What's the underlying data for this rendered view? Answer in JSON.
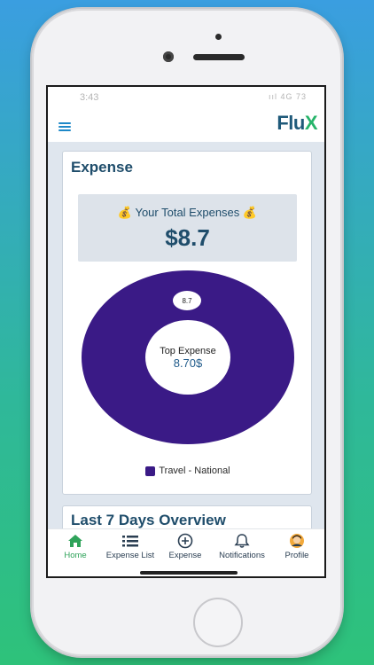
{
  "status": {
    "time": "3:43",
    "icons": "ııl 4G 73"
  },
  "app": {
    "logo_left": "Flu",
    "logo_right": "X"
  },
  "expense_card": {
    "title": "Expense",
    "total_label": "Your Total Expenses",
    "total_value": "$8.7",
    "moneybag": "💰"
  },
  "chart_data": {
    "type": "pie",
    "slices": [
      {
        "label": "Travel - National",
        "value": 8.7,
        "color": "#3a1a86"
      }
    ],
    "slice_label": "8.7",
    "center_title": "Top Expense",
    "center_value": "8.70$"
  },
  "overview_card": {
    "title": "Last 7 Days Overview"
  },
  "tabs": [
    {
      "label": "Home",
      "icon": "home-icon"
    },
    {
      "label": "Expense List",
      "icon": "list-icon"
    },
    {
      "label": "Expense",
      "icon": "plus-circle-icon"
    },
    {
      "label": "Notifications",
      "icon": "bell-icon"
    },
    {
      "label": "Profile",
      "icon": "avatar-icon"
    }
  ],
  "colors": {
    "accent": "#1f4d6b",
    "active_tab": "#2fa35a",
    "pie": "#3a1a86"
  }
}
